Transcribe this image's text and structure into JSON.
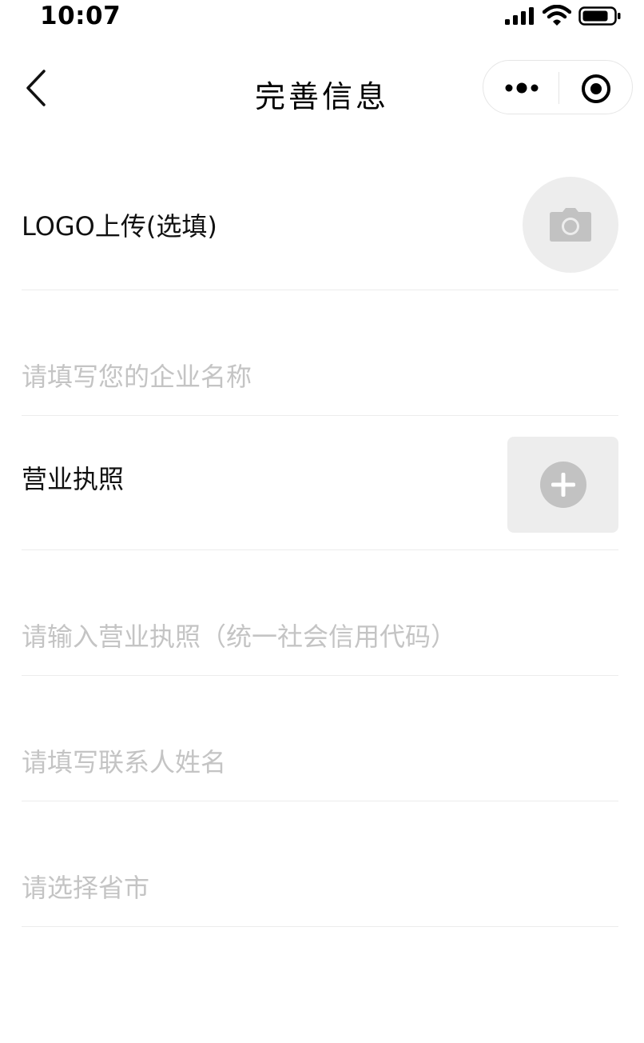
{
  "status_bar": {
    "time": "10:07",
    "icons": [
      "signal-icon",
      "wifi-icon",
      "battery-icon"
    ]
  },
  "nav": {
    "title": "完善信息",
    "icons": [
      "back-chevron-icon",
      "more-dots-icon",
      "record-circle-icon"
    ]
  },
  "form": {
    "logo_label": "LOGO上传(选填)",
    "logo_upload_icon": "camera-icon",
    "company_name_placeholder": "请填写您的企业名称",
    "license_label": "营业执照",
    "license_upload_icon": "plus-circle-icon",
    "license_code_placeholder": "请输入营业执照（统一社会信用代码）",
    "contact_name_placeholder": "请填写联系人姓名",
    "region_placeholder": "请选择省市"
  },
  "colors": {
    "placeholder": "#c4c4c4",
    "divider": "#ececec",
    "upload_bg": "#ededed",
    "upload_icon": "#c2c2c2"
  }
}
